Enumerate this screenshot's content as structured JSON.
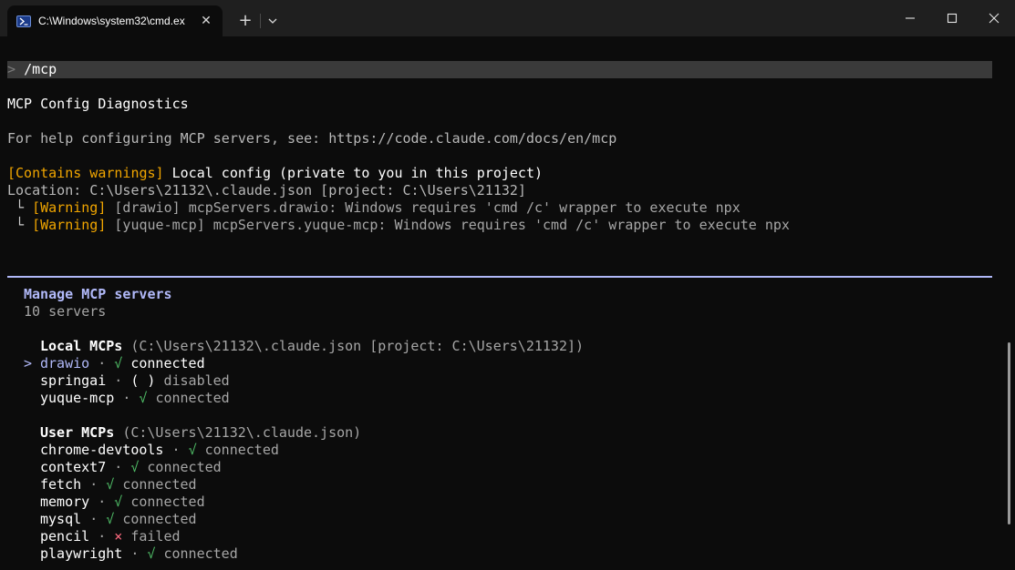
{
  "window": {
    "tab_title": "C:\\Windows\\system32\\cmd.ex",
    "tab_icon": "powershell-icon",
    "close_tab_symbol": "✕",
    "new_tab_symbol": "+"
  },
  "prompt": {
    "caret": ">",
    "command": "/mcp"
  },
  "diagnostics": {
    "heading": "MCP Config Diagnostics",
    "help_line": "For help configuring MCP servers, see: https://code.claude.com/docs/en/mcp",
    "local_config": {
      "tag": "[Contains warnings]",
      "title": "Local config (private to you in this project)",
      "location": "Location: C:\\Users\\21132\\.claude.json [project: C:\\Users\\21132]"
    },
    "warnings": [
      {
        "branch": "└",
        "tag": "[Warning]",
        "server": "[drawio]",
        "message": "mcpServers.drawio: Windows requires 'cmd /c' wrapper to execute npx"
      },
      {
        "branch": "└",
        "tag": "[Warning]",
        "server": "[yuque-mcp]",
        "message": "mcpServers.yuque-mcp: Windows requires 'cmd /c' wrapper to execute npx"
      }
    ]
  },
  "manager": {
    "title": "Manage MCP servers",
    "count": "10 servers",
    "selector": ">",
    "local_group": {
      "label": "Local MCPs",
      "path": "(C:\\Users\\21132\\.claude.json [project: C:\\Users\\21132])"
    },
    "local_servers": [
      {
        "name": "drawio",
        "sep": "·",
        "icon": "√",
        "status": "connected"
      },
      {
        "name": "springai",
        "sep": "·",
        "icon": "( )",
        "status": "disabled"
      },
      {
        "name": "yuque-mcp",
        "sep": "·",
        "icon": "√",
        "status": "connected"
      }
    ],
    "user_group": {
      "label": "User MCPs",
      "path": "(C:\\Users\\21132\\.claude.json)"
    },
    "user_servers": [
      {
        "name": "chrome-devtools",
        "sep": "·",
        "icon": "√",
        "status": "connected"
      },
      {
        "name": "context7",
        "sep": "·",
        "icon": "√",
        "status": "connected"
      },
      {
        "name": "fetch",
        "sep": "·",
        "icon": "√",
        "status": "connected"
      },
      {
        "name": "memory",
        "sep": "·",
        "icon": "√",
        "status": "connected"
      },
      {
        "name": "mysql",
        "sep": "·",
        "icon": "√",
        "status": "connected"
      },
      {
        "name": "pencil",
        "sep": "·",
        "icon": "×",
        "status": "failed"
      },
      {
        "name": "playwright",
        "sep": "·",
        "icon": "√",
        "status": "connected"
      }
    ]
  },
  "colors": {
    "background": "#0c0c0c",
    "warning": "#f0a500",
    "accent": "#b1b9f9",
    "success": "#4eba65",
    "error": "#ff6b80"
  }
}
